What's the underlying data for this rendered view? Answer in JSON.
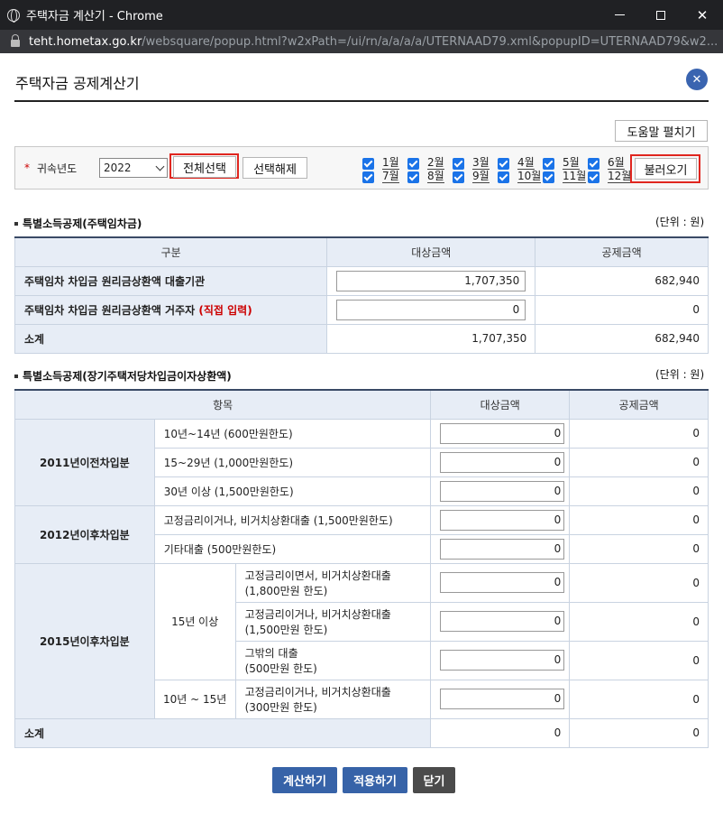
{
  "window": {
    "title": "주택자금 계산기 - Chrome",
    "url_host": "teht.hometax.go.kr",
    "url_path": "/websquare/popup.html?w2xPath=/ui/rn/a/a/a/a/UTERNAAD79.xml&popupID=UTERNAAD79&w2..."
  },
  "popup": {
    "title": "주택자금 공제계산기",
    "close_glyph": "✕",
    "help_label": "도움말 펼치기"
  },
  "filter": {
    "required_mark": "*",
    "year_label": "귀속년도",
    "year_value": "2022",
    "select_all_label": "전체선택",
    "deselect_label": "선택해제",
    "months_row1": [
      "1월",
      "2월",
      "3월",
      "4월",
      "5월",
      "6월"
    ],
    "months_row2": [
      "7월",
      "8월",
      "9월",
      "10월",
      "11월",
      "12월"
    ],
    "load_label": "불러오기"
  },
  "section1": {
    "title": "특별소득공제(주택임차금)",
    "unit": "(단위 : 원)",
    "headers": [
      "구분",
      "대상금액",
      "공제금액"
    ],
    "row1_label": "주택임차 차입금 원리금상환액 대출기관",
    "row1_target": "1,707,350",
    "row1_deduct": "682,940",
    "row2_label": "주택임차 차입금 원리금상환액 거주자",
    "row2_direct": "(직접 입력)",
    "row2_target": "0",
    "row2_deduct": "0",
    "subtotal_label": "소계",
    "subtotal_target": "1,707,350",
    "subtotal_deduct": "682,940"
  },
  "section2": {
    "title": "특별소득공제(장기주택저당차입금이자상환액)",
    "unit": "(단위 : 원)",
    "headers": [
      "항목",
      "대상금액",
      "공제금액"
    ],
    "g2011": "2011년이전차입분",
    "r2011a": "10년~14년 (600만원한도)",
    "r2011b": "15~29년 (1,000만원한도)",
    "r2011c": "30년 이상 (1,500만원한도)",
    "g2012": "2012년이후차입분",
    "r2012a": "고정금리이거나, 비거치상환대출 (1,500만원한도)",
    "r2012b": "기타대출 (500만원한도)",
    "g2015": "2015년이후차입분",
    "s15": "15년 이상",
    "r15a_1": "고정금리이면서, 비거치상환대출",
    "r15a_2": "(1,800만원 한도)",
    "r15b_1": "고정금리이거나, 비거치상환대출",
    "r15b_2": "(1,500만원 한도)",
    "r15c_1": "그밖의 대출",
    "r15c_2": "(500만원 한도)",
    "s10": "10년 ~ 15년",
    "r10a_1": "고정금리이거나, 비거치상환대출",
    "r10a_2": "(300만원 한도)",
    "input_value": "0",
    "deduct_value": "0",
    "subtotal_label": "소계",
    "subtotal_target": "0",
    "subtotal_deduct": "0"
  },
  "actions": {
    "calculate": "계산하기",
    "apply": "적용하기",
    "close": "닫기"
  }
}
